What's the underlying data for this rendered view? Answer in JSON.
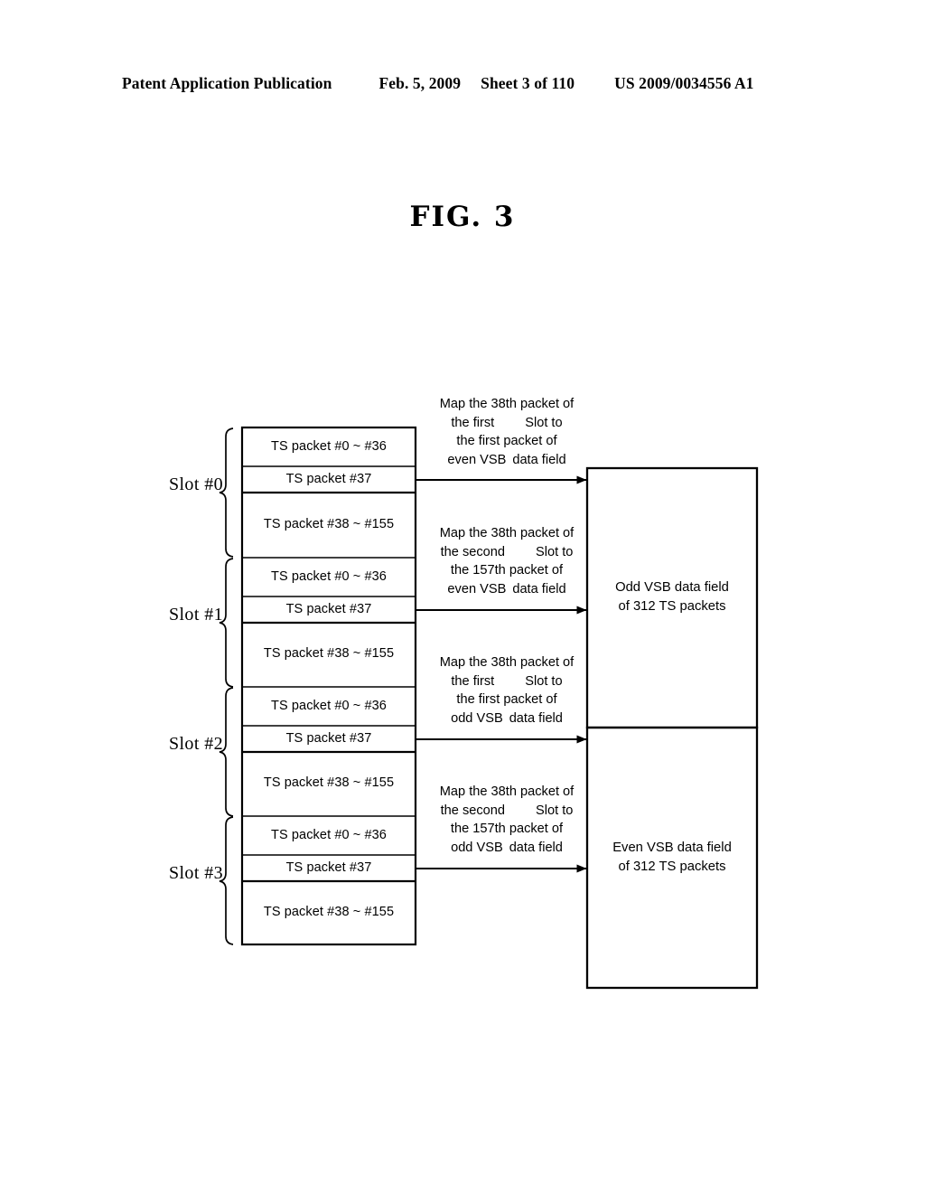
{
  "header": {
    "publication": "Patent Application Publication",
    "date": "Feb. 5, 2009",
    "sheet": "Sheet 3 of 110",
    "number": "US 2009/0034556 A1"
  },
  "figure": {
    "title": "FIG. 3"
  },
  "slots": [
    {
      "label": "Slot #0",
      "rows": [
        {
          "text": "TS packet #0 ~ #36"
        },
        {
          "text": "TS packet #37"
        },
        {
          "text": "TS packet #38 ~ #155"
        }
      ]
    },
    {
      "label": "Slot #1",
      "rows": [
        {
          "text": "TS packet #0 ~ #36"
        },
        {
          "text": "TS packet #37"
        },
        {
          "text": "TS packet #38 ~ #155"
        }
      ]
    },
    {
      "label": "Slot #2",
      "rows": [
        {
          "text": "TS packet #0 ~ #36"
        },
        {
          "text": "TS packet #37"
        },
        {
          "text": "TS packet #38 ~ #155"
        }
      ]
    },
    {
      "label": "Slot #3",
      "rows": [
        {
          "text": "TS packet #0 ~ #36"
        },
        {
          "text": "TS packet #37"
        },
        {
          "text": "TS packet #38 ~ #155"
        }
      ]
    }
  ],
  "annotations": [
    {
      "line1": "Map the 38th packet of",
      "line2a": "the first",
      "line2b": "Slot to",
      "line3": "the first packet of",
      "line4a": "even VSB",
      "line4b": "data field"
    },
    {
      "line1": "Map the 38th packet of",
      "line2a": "the second",
      "line2b": "Slot to",
      "line3": "the 157th packet of",
      "line4a": "even VSB",
      "line4b": "data field"
    },
    {
      "line1": "Map the 38th packet of",
      "line2a": "the first",
      "line2b": "Slot to",
      "line3": "the first packet of",
      "line4a": "odd VSB",
      "line4b": "data field"
    },
    {
      "line1": "Map the 38th packet of",
      "line2a": "the second",
      "line2b": "Slot to",
      "line3": "the 157th packet of",
      "line4a": "odd VSB",
      "line4b": "data field"
    }
  ],
  "vsb_fields": [
    {
      "line1": "Odd VSB data field",
      "line2": "of 312 TS packets"
    },
    {
      "line1": "Even VSB data field",
      "line2": "of 312 TS packets"
    }
  ]
}
